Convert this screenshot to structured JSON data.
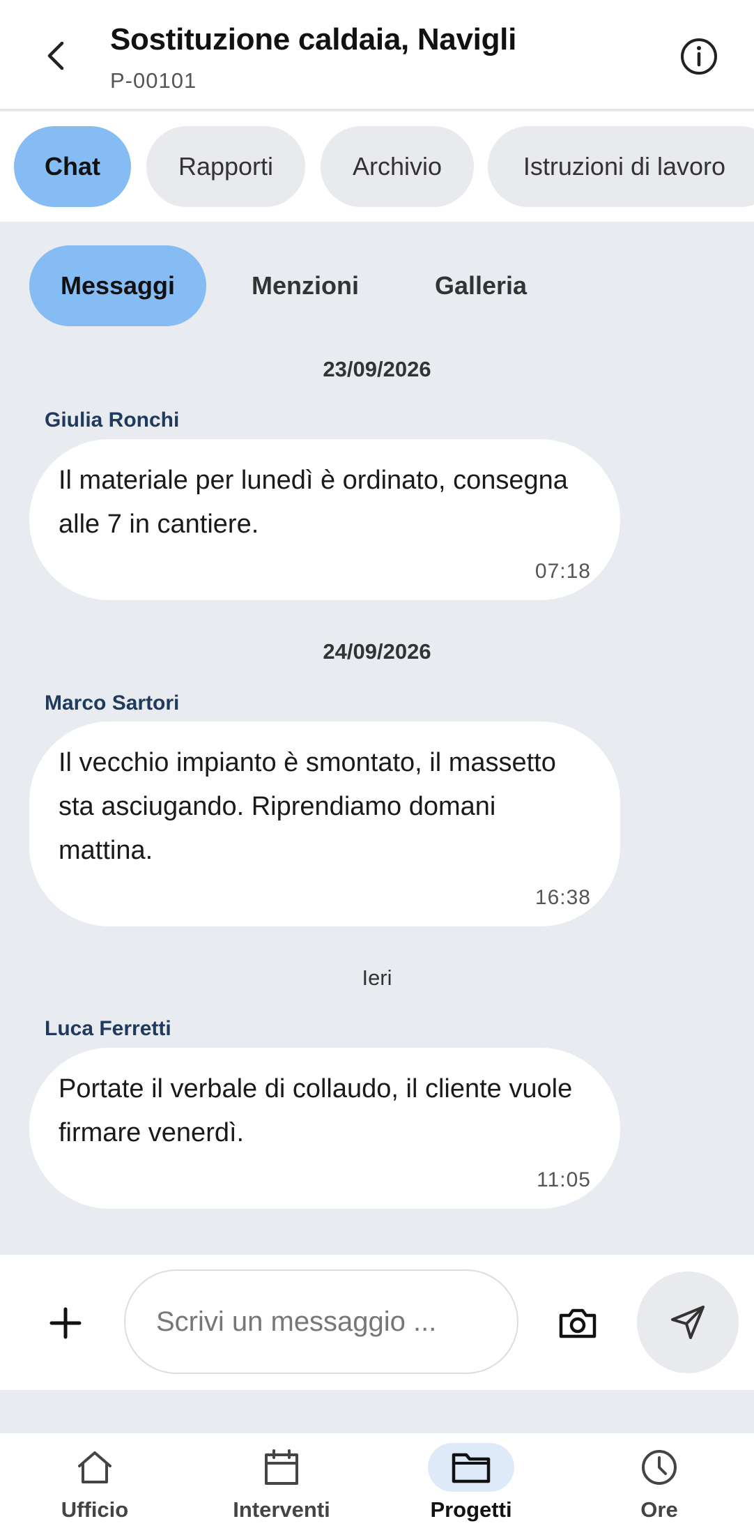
{
  "header": {
    "title": "Sostituzione caldaia, Navigli",
    "subtitle": "P-00101",
    "back_icon": "chevron-left-icon",
    "info_icon": "info-icon"
  },
  "top_tabs": [
    {
      "label": "Chat",
      "active": true
    },
    {
      "label": "Rapporti",
      "active": false
    },
    {
      "label": "Archivio",
      "active": false
    },
    {
      "label": "Istruzioni di lavoro",
      "active": false
    }
  ],
  "sub_tabs": [
    {
      "label": "Messaggi",
      "active": true
    },
    {
      "label": "Menzioni",
      "active": false
    },
    {
      "label": "Galleria",
      "active": false
    }
  ],
  "messages": [
    {
      "date": "23/09/2026",
      "sender": "Giulia Ronchi",
      "text": "Il materiale per lunedì è ordinato, consegna alle 7 in cantiere.",
      "time": "07:18"
    },
    {
      "date": "24/09/2026",
      "sender": "Marco Sartori",
      "text": "Il vecchio impianto è smontato, il massetto sta asciugando. Riprendiamo domani mattina.",
      "time": "16:38"
    },
    {
      "date": "Ieri",
      "sender": "Luca Ferretti",
      "text": "Portate il verbale di collaudo, il cliente vuole firmare venerdì.",
      "time": "11:05"
    }
  ],
  "composer": {
    "placeholder": "Scrivi un messaggio ...",
    "value": "",
    "icons": [
      "plus-icon",
      "camera-icon",
      "send-icon"
    ]
  },
  "bottom_nav": [
    {
      "label": "Ufficio",
      "icon": "home-icon",
      "active": false
    },
    {
      "label": "Interventi",
      "icon": "calendar-icon",
      "active": false
    },
    {
      "label": "Progetti",
      "icon": "folder-icon",
      "active": true
    },
    {
      "label": "Ore",
      "icon": "clock-icon",
      "active": false
    }
  ],
  "colors": {
    "accent": "#85bcf3",
    "accent_light": "#dfeaf8",
    "background": "#e8ebef",
    "sender_name": "#1f3a5c"
  }
}
